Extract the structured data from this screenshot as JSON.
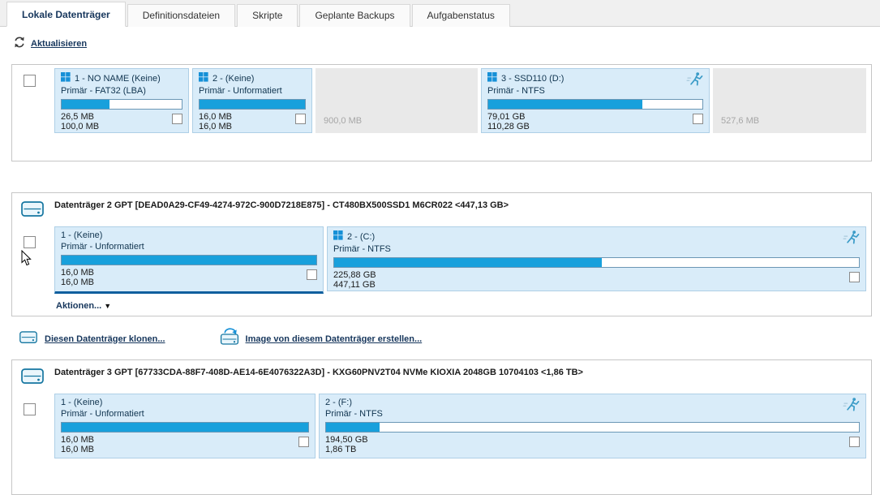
{
  "tabs": [
    {
      "label": "Lokale Datenträger"
    },
    {
      "label": "Definitionsdateien"
    },
    {
      "label": "Skripte"
    },
    {
      "label": "Geplante Backups"
    },
    {
      "label": "Aufgabenstatus"
    }
  ],
  "toolbar": {
    "refresh": "Aktualisieren"
  },
  "disk1": {
    "p1": {
      "title": "1 - NO NAME (Keine)",
      "subtitle": "Primär - FAT32 (LBA)",
      "used": "26,5 MB",
      "total": "100,0 MB",
      "fill": "40%"
    },
    "p2": {
      "title": "2 -  (Keine)",
      "subtitle": "Primär - Unformatiert",
      "used": "16,0 MB",
      "total": "16,0 MB",
      "fill": "100%"
    },
    "free1": {
      "size": "900,0 MB"
    },
    "p3": {
      "title": "3 - SSD110 (D:)",
      "subtitle": "Primär - NTFS",
      "used": "79,01 GB",
      "total": "110,28 GB",
      "fill": "72%"
    },
    "free2": {
      "size": "527,6 MB"
    }
  },
  "disk2": {
    "title": "Datenträger 2 GPT [DEAD0A29-CF49-4274-972C-900D7218E875] - CT480BX500SSD1  M6CR022  <447,13 GB>",
    "p1": {
      "title": "1 -  (Keine)",
      "subtitle": "Primär - Unformatiert",
      "used": "16,0 MB",
      "total": "16,0 MB",
      "fill": "100%"
    },
    "p2": {
      "title": "2 -  (C:)",
      "subtitle": "Primär - NTFS",
      "used": "225,88 GB",
      "total": "447,11 GB",
      "fill": "51%"
    },
    "actions": "Aktionen..."
  },
  "links": {
    "clone": "Diesen Datenträger klonen...",
    "image": "Image von diesem Datenträger erstellen..."
  },
  "disk3": {
    "title": "Datenträger 3 GPT [67733CDA-88F7-408D-AE14-6E4076322A3D] - KXG60PNV2T04 NVMe KIOXIA 2048GB 10704103  <1,86 TB>",
    "p1": {
      "title": "1 -  (Keine)",
      "subtitle": "Primär - Unformatiert",
      "used": "16,0 MB",
      "total": "16,0 MB",
      "fill": "100%"
    },
    "p2": {
      "title": "2 -  (F:)",
      "subtitle": "Primär - NTFS",
      "used": "194,50 GB",
      "total": "1,86 TB",
      "fill": "10%"
    }
  }
}
